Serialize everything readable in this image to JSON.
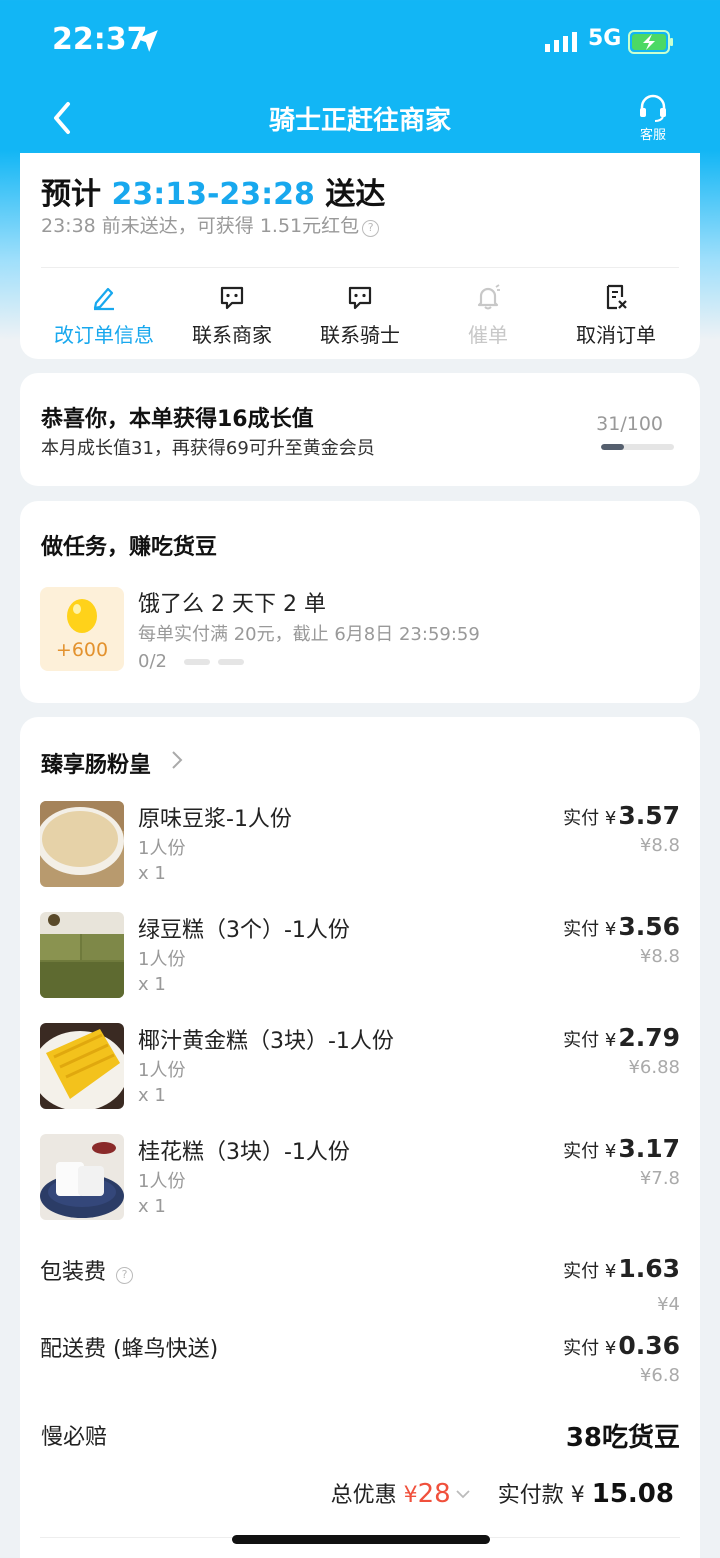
{
  "status_bar": {
    "time": "22:37",
    "network": "5G"
  },
  "nav": {
    "title": "骑士正赶往商家",
    "service_label": "客服"
  },
  "delivery": {
    "eta_prefix": "预计",
    "eta_time": "23:13-23:28",
    "eta_suffix": "送达",
    "compensation": "23:38 前未送达，可获得 1.51元红包",
    "help_glyph": "?",
    "actions": [
      {
        "label": "改订单信息",
        "icon": "edit-icon",
        "state": "active"
      },
      {
        "label": "联系商家",
        "icon": "chat-icon",
        "state": "normal"
      },
      {
        "label": "联系骑士",
        "icon": "chat-icon",
        "state": "normal"
      },
      {
        "label": "催单",
        "icon": "bell-icon",
        "state": "disabled"
      },
      {
        "label": "取消订单",
        "icon": "cancel-doc-icon",
        "state": "normal"
      }
    ]
  },
  "growth": {
    "title": "恭喜你，本单获得16成长值",
    "subtitle": "本月成长值31，再获得69可升至黄金会员",
    "progress_text": "31/100",
    "progress_fraction": 0.31
  },
  "task": {
    "section_title": "做任务，赚吃货豆",
    "reward": "+600",
    "name": "饿了么 2 天下 2 单",
    "desc": "每单实付满 20元，截止 6月8日 23:59:59",
    "progress": "0/2",
    "progress_fraction": 0
  },
  "order": {
    "shop_name": "臻享肠粉皇",
    "paid_prefix": "实付 ¥",
    "items": [
      {
        "name": "原味豆浆-1人份",
        "spec": "1人份",
        "qty": "x 1",
        "paid": "3.57",
        "original": "¥8.8"
      },
      {
        "name": "绿豆糕（3个）-1人份",
        "spec": "1人份",
        "qty": "x 1",
        "paid": "3.56",
        "original": "¥8.8"
      },
      {
        "name": "椰汁黄金糕（3块）-1人份",
        "spec": "1人份",
        "qty": "x 1",
        "paid": "2.79",
        "original": "¥6.88"
      },
      {
        "name": "桂花糕（3块）-1人份",
        "spec": "1人份",
        "qty": "x 1",
        "paid": "3.17",
        "original": "¥7.8"
      }
    ],
    "packaging": {
      "label": "包装费",
      "paid_prefix": "实付 ¥",
      "paid": "1.63",
      "original": "¥4"
    },
    "delivery_fee": {
      "label": "配送费 (蜂鸟快送)",
      "paid_prefix": "实付 ¥",
      "paid": "0.36",
      "original": "¥6.8"
    },
    "slow_compensation": {
      "label": "慢必赔",
      "value": "38吃货豆"
    },
    "summary": {
      "discount_label": "总优惠",
      "discount_symbol": "¥",
      "discount": "28",
      "total_label": "实付款",
      "total_symbol": "¥",
      "total": "15.08"
    }
  },
  "colors": {
    "brand": "#12b6f5",
    "accent": "#18a8ee",
    "discount": "#f0503c",
    "bean": "#e3922e"
  }
}
